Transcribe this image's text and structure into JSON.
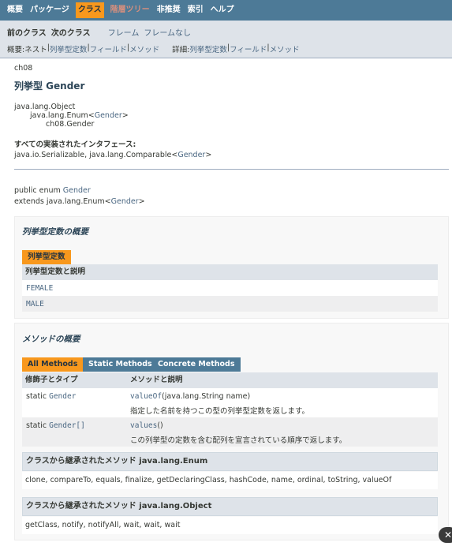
{
  "topnav": {
    "items": [
      "概要",
      "パッケージ",
      "クラス",
      "階層ツリー",
      "非推奨",
      "索引",
      "ヘルプ"
    ]
  },
  "subnav": {
    "prev_class": "前のクラス",
    "next_class": "次のクラス",
    "frames": "フレーム",
    "no_frames": "フレームなし",
    "summary_label": "概要: ",
    "summary_nested": "ネスト",
    "summary_enum": "列挙型定数",
    "summary_field": "フィールド",
    "summary_method": "メソッド",
    "detail_label": "詳細: ",
    "detail_enum": "列挙型定数",
    "detail_field": "フィールド",
    "detail_method": "メソッド",
    "sep": " | "
  },
  "header": {
    "package": "ch08",
    "title": "列挙型 Gender"
  },
  "hierarchy": [
    "java.lang.Object",
    "java.lang.Enum<",
    "Gender",
    ">",
    "ch08.Gender"
  ],
  "interfaces": {
    "label": "すべての実装されたインタフェース:",
    "text_pre": "java.io.Serializable, java.lang.Comparable<",
    "link": "Gender",
    "text_post": ">"
  },
  "declaration": {
    "line1_pre": "public enum ",
    "line1_name": "Gender",
    "line2_pre": "extends java.lang.Enum<",
    "line2_link": "Gender",
    "line2_post": ">"
  },
  "enum_summary": {
    "heading": "列挙型定数の概要",
    "tab": "列挙型定数",
    "col_header": "列挙型定数と説明",
    "constants": [
      "FEMALE",
      "MALE"
    ]
  },
  "method_summary": {
    "heading": "メソッドの概要",
    "tabs": [
      "All Methods",
      "Static Methods",
      "Concrete Methods"
    ],
    "col_modifier": "修飾子とタイプ",
    "col_method": "メソッドと説明",
    "rows": [
      {
        "modifier": "static ",
        "type": "Gender",
        "method": "valueOf",
        "params": "(java.lang.String name)",
        "desc": "指定した名前を持つこの型の列挙型定数を返します。"
      },
      {
        "modifier": "static ",
        "type": "Gender[]",
        "method": "values",
        "params": "()",
        "desc": "この列挙型の定数を含む配列を宣言されている順序で返します。"
      }
    ]
  },
  "inherited": [
    {
      "heading": "クラスから継承されたメソッド java.lang.Enum",
      "methods": "clone, compareTo, equals, finalize, getDeclaringClass, hashCode, name, ordinal, toString, valueOf"
    },
    {
      "heading": "クラスから継承されたメソッド java.lang.Object",
      "methods": "getClass, notify, notifyAll, wait, wait, wait"
    }
  ]
}
